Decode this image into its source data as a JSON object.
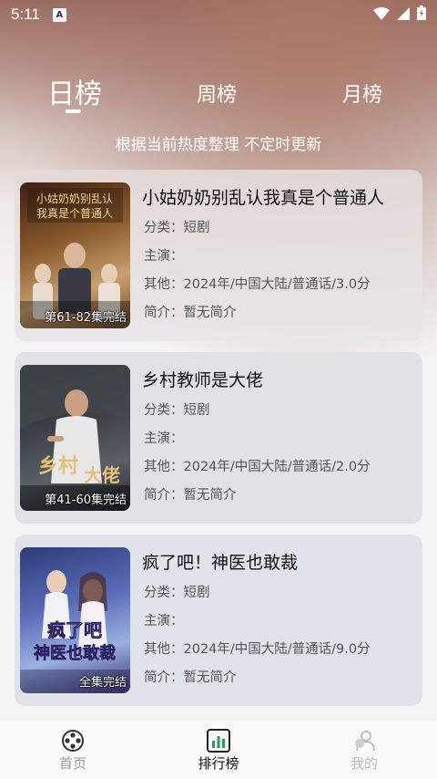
{
  "status_bar": {
    "time": "5:11",
    "notification_icon": "A",
    "icons": [
      "wifi-icon",
      "signal-icon",
      "battery-icon"
    ]
  },
  "tabs": [
    {
      "label": "日榜",
      "active": true
    },
    {
      "label": "周榜",
      "active": false
    },
    {
      "label": "月榜",
      "active": false
    }
  ],
  "subtitle": "根据当前热度整理 不定时更新",
  "items": [
    {
      "title": "小姑奶奶别乱认我真是个普通人",
      "category": "分类：短剧",
      "cast": "主演：",
      "other": "其他：2024年/中国大陆/普通话/3.0分",
      "intro": "简介：暂无简介",
      "badge": "第61-82集完结",
      "poster_text": "小姑奶奶别乱认我真是个普通人"
    },
    {
      "title": "乡村教师是大佬",
      "category": "分类：短剧",
      "cast": "主演：",
      "other": "其他：2024年/中国大陆/普通话/2.0分",
      "intro": "简介：暂无简介",
      "badge": "第41-60集完结",
      "poster_text": "乡村教师是大佬"
    },
    {
      "title": "疯了吧！神医也敢裁",
      "category": "分类：短剧",
      "cast": "主演：",
      "other": "其他：2024年/中国大陆/普通话/9.0分",
      "intro": "简介：暂无简介",
      "badge": "全集完结",
      "poster_text": "疯了吧 神医也敢裁"
    }
  ],
  "bottom_nav": [
    {
      "label": "首页",
      "icon": "film-reel-icon",
      "active": false
    },
    {
      "label": "排行榜",
      "icon": "bar-chart-icon",
      "active": true
    },
    {
      "label": "我的",
      "icon": "user-icon",
      "active": false
    }
  ],
  "colors": {
    "header_gradient_top": "#9a6c60",
    "background": "#f3f3f3",
    "active_nav": "#111111",
    "inactive_nav": "#999999"
  }
}
